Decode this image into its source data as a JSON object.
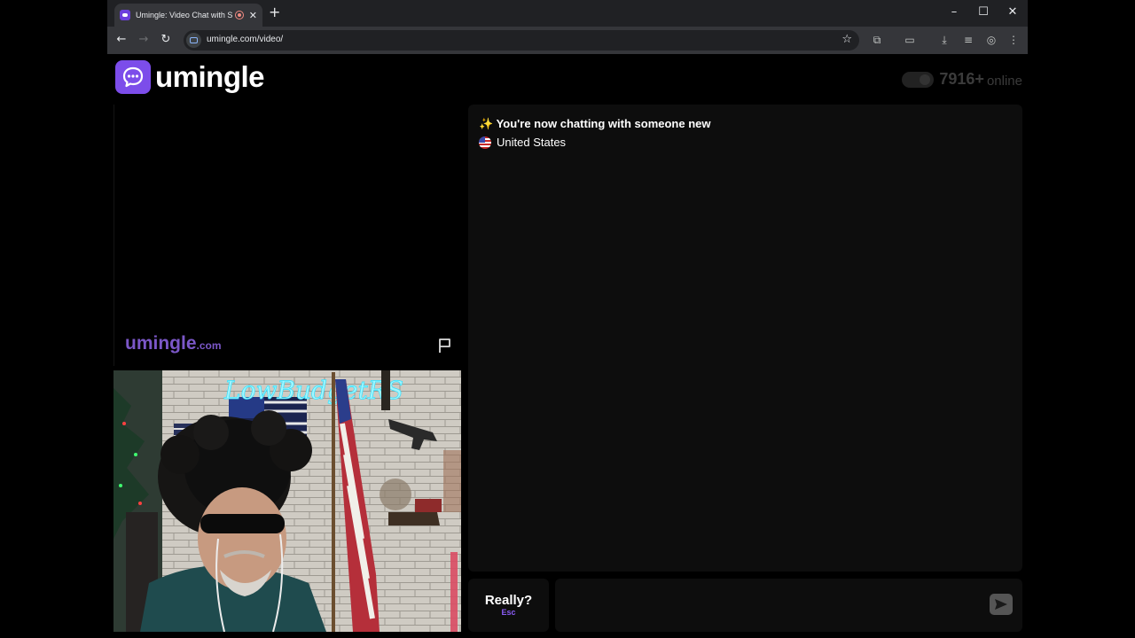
{
  "browser": {
    "tab_title": "Umingle: Video Chat with S",
    "url": "umingle.com/video/"
  },
  "site": {
    "logo_text": "umingle",
    "online_count": "7916+",
    "online_label": "online"
  },
  "stranger_video": {
    "watermark_main": "umingle",
    "watermark_tld": ".com"
  },
  "self_video": {
    "neon_sign_text": "LowBudgetRS"
  },
  "chat": {
    "status_icon": "✨",
    "status_message": "You're now chatting with someone new",
    "partner_country": "United States",
    "message_value": ""
  },
  "controls": {
    "skip_label": "Really?",
    "skip_key": "Esc"
  },
  "colors": {
    "brand": "#7c4dea",
    "watermark": "#7b57c8",
    "skip_key": "#8a5cf5"
  }
}
